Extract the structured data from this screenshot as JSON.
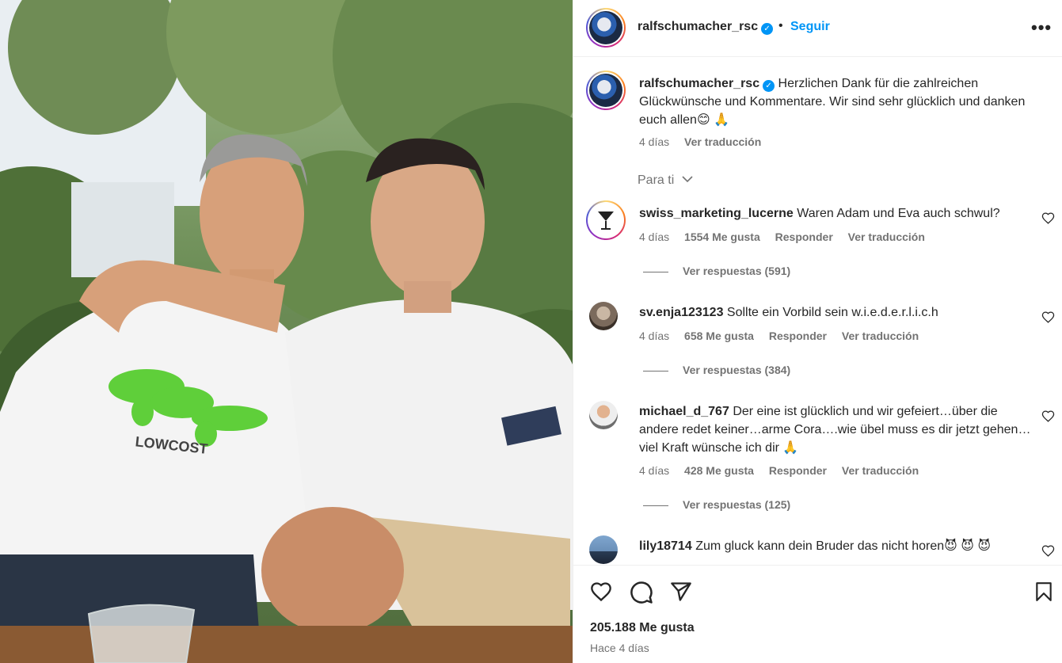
{
  "post": {
    "username": "ralfschumacher_rsc",
    "verified_mark": "✓",
    "separator": "•",
    "follow_label": "Seguir",
    "more_label": "•••",
    "caption": "Herzlichen Dank für die zahlreichen Glückwünsche und Kommentare. Wir sind sehr glücklich und danken euch allen😊 🙏",
    "caption_age": "4 días",
    "caption_translate": "Ver traducción",
    "sort_label": "Para ti",
    "shirt_print": "LOWCOST",
    "likes": "205.188 Me gusta",
    "posted": "Hace 4 días"
  },
  "comments": [
    {
      "user": "swiss_marketing_lucerne",
      "text": "Waren Adam und Eva auch schwul?",
      "age": "4 días",
      "likes": "1554 Me gusta",
      "reply": "Responder",
      "translate": "Ver traducción",
      "replies": "Ver respuestas (591)",
      "avatar": "cocktail-avatar"
    },
    {
      "user": "sv.enja123123",
      "text": "Sollte ein Vorbild sein w.i.e.d.e.r.l.i.c.h",
      "age": "4 días",
      "likes": "658 Me gusta",
      "reply": "Responder",
      "translate": "Ver traducción",
      "replies": "Ver respuestas (384)",
      "avatar": "person-avatar"
    },
    {
      "user": "michael_d_767",
      "text": "Der eine ist glücklich und wir gefeiert…über die andere redet keiner…arme Cora….wie übel muss es dir jetzt gehen…viel Kraft wünsche ich dir 🙏",
      "age": "4 días",
      "likes": "428 Me gusta",
      "reply": "Responder",
      "translate": "Ver traducción",
      "replies": "Ver respuestas (125)",
      "avatar": "man-avatar"
    },
    {
      "user": "lily18714",
      "text": "Zum gluck kann dein Bruder das nicht horen😈 😈 😈",
      "avatar": "skyline-avatar"
    }
  ],
  "icons": {
    "like": "heart-icon",
    "comment": "comment-icon",
    "share": "send-icon",
    "save": "bookmark-icon"
  },
  "colors": {
    "accent": "#0095f6",
    "muted": "#737373",
    "text": "#262626",
    "border": "#efefef"
  }
}
